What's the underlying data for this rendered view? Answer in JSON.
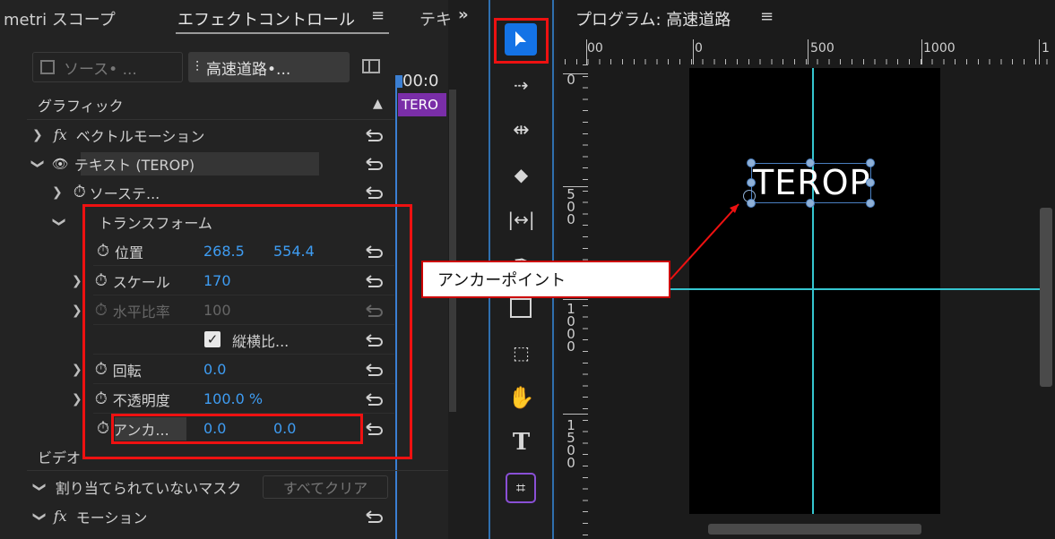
{
  "left_panel": {
    "tabs": [
      "metri スコープ",
      "エフェクトコントロール",
      "テキ"
    ],
    "tab_menu": "≡",
    "tabs_overflow": "»",
    "source_button": "ソース• ...",
    "sequence_button": "高速道路•...",
    "timecode": "00:0",
    "clip_label": "TERO",
    "section_graphic": "グラフィック",
    "rows": {
      "vector_motion": "ベクトルモーション",
      "text_layer": "テキスト (TEROP)",
      "source_text": "ソーステ...",
      "transform": "トランスフォーム",
      "position": {
        "label": "位置",
        "x": "268.5",
        "y": "554.4"
      },
      "scale": {
        "label": "スケール",
        "value": "170"
      },
      "width_scale": {
        "label": "水平比率",
        "value": "100"
      },
      "uniform": {
        "label": "縦横比...",
        "checked": true
      },
      "rotation": {
        "label": "回転",
        "value": "0.0"
      },
      "opacity": {
        "label": "不透明度",
        "value": "100.0 %"
      },
      "anchor": {
        "label": "アンカ...",
        "x": "0.0",
        "y": "0.0"
      }
    },
    "section_video": "ビデオ",
    "mask_row": {
      "label": "割り当てられていないマスク",
      "button": "すべてクリア"
    },
    "motion_row": "モーション"
  },
  "program": {
    "title": "プログラム: 高速道路",
    "menu": "≡",
    "ruler_h": [
      "00",
      "0",
      "500",
      "1000",
      "1"
    ],
    "ruler_v": [
      [
        "0"
      ],
      [
        "5",
        "0",
        "0"
      ],
      [
        "1",
        "0",
        "0",
        "0"
      ],
      [
        "1",
        "5",
        "0",
        "0"
      ]
    ],
    "text_object": "TEROP"
  },
  "callout": {
    "text": "アンカーポイント"
  },
  "colors": {
    "accent_blue": "#3e9cf2",
    "highlight_red": "#e11111",
    "guide_cyan": "#35c6d0",
    "clip_purple": "#7a2ea8",
    "tool_active": "#1473e6"
  }
}
